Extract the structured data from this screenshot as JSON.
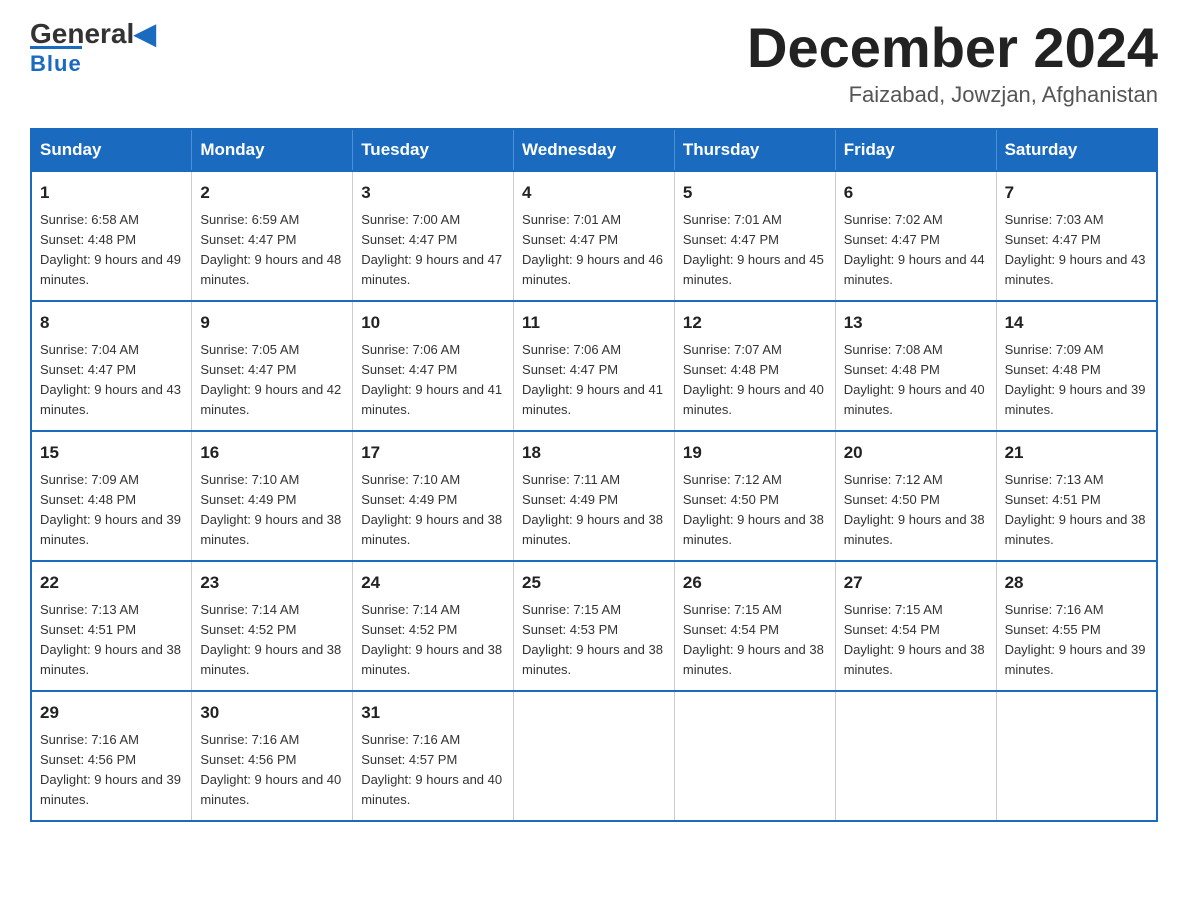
{
  "header": {
    "logo": {
      "general": "General",
      "blue": "Blue",
      "arrow": "▶"
    },
    "title": "December 2024",
    "location": "Faizabad, Jowzjan, Afghanistan"
  },
  "days_of_week": [
    "Sunday",
    "Monday",
    "Tuesday",
    "Wednesday",
    "Thursday",
    "Friday",
    "Saturday"
  ],
  "weeks": [
    [
      {
        "day": "1",
        "sunrise": "Sunrise: 6:58 AM",
        "sunset": "Sunset: 4:48 PM",
        "daylight": "Daylight: 9 hours and 49 minutes."
      },
      {
        "day": "2",
        "sunrise": "Sunrise: 6:59 AM",
        "sunset": "Sunset: 4:47 PM",
        "daylight": "Daylight: 9 hours and 48 minutes."
      },
      {
        "day": "3",
        "sunrise": "Sunrise: 7:00 AM",
        "sunset": "Sunset: 4:47 PM",
        "daylight": "Daylight: 9 hours and 47 minutes."
      },
      {
        "day": "4",
        "sunrise": "Sunrise: 7:01 AM",
        "sunset": "Sunset: 4:47 PM",
        "daylight": "Daylight: 9 hours and 46 minutes."
      },
      {
        "day": "5",
        "sunrise": "Sunrise: 7:01 AM",
        "sunset": "Sunset: 4:47 PM",
        "daylight": "Daylight: 9 hours and 45 minutes."
      },
      {
        "day": "6",
        "sunrise": "Sunrise: 7:02 AM",
        "sunset": "Sunset: 4:47 PM",
        "daylight": "Daylight: 9 hours and 44 minutes."
      },
      {
        "day": "7",
        "sunrise": "Sunrise: 7:03 AM",
        "sunset": "Sunset: 4:47 PM",
        "daylight": "Daylight: 9 hours and 43 minutes."
      }
    ],
    [
      {
        "day": "8",
        "sunrise": "Sunrise: 7:04 AM",
        "sunset": "Sunset: 4:47 PM",
        "daylight": "Daylight: 9 hours and 43 minutes."
      },
      {
        "day": "9",
        "sunrise": "Sunrise: 7:05 AM",
        "sunset": "Sunset: 4:47 PM",
        "daylight": "Daylight: 9 hours and 42 minutes."
      },
      {
        "day": "10",
        "sunrise": "Sunrise: 7:06 AM",
        "sunset": "Sunset: 4:47 PM",
        "daylight": "Daylight: 9 hours and 41 minutes."
      },
      {
        "day": "11",
        "sunrise": "Sunrise: 7:06 AM",
        "sunset": "Sunset: 4:47 PM",
        "daylight": "Daylight: 9 hours and 41 minutes."
      },
      {
        "day": "12",
        "sunrise": "Sunrise: 7:07 AM",
        "sunset": "Sunset: 4:48 PM",
        "daylight": "Daylight: 9 hours and 40 minutes."
      },
      {
        "day": "13",
        "sunrise": "Sunrise: 7:08 AM",
        "sunset": "Sunset: 4:48 PM",
        "daylight": "Daylight: 9 hours and 40 minutes."
      },
      {
        "day": "14",
        "sunrise": "Sunrise: 7:09 AM",
        "sunset": "Sunset: 4:48 PM",
        "daylight": "Daylight: 9 hours and 39 minutes."
      }
    ],
    [
      {
        "day": "15",
        "sunrise": "Sunrise: 7:09 AM",
        "sunset": "Sunset: 4:48 PM",
        "daylight": "Daylight: 9 hours and 39 minutes."
      },
      {
        "day": "16",
        "sunrise": "Sunrise: 7:10 AM",
        "sunset": "Sunset: 4:49 PM",
        "daylight": "Daylight: 9 hours and 38 minutes."
      },
      {
        "day": "17",
        "sunrise": "Sunrise: 7:10 AM",
        "sunset": "Sunset: 4:49 PM",
        "daylight": "Daylight: 9 hours and 38 minutes."
      },
      {
        "day": "18",
        "sunrise": "Sunrise: 7:11 AM",
        "sunset": "Sunset: 4:49 PM",
        "daylight": "Daylight: 9 hours and 38 minutes."
      },
      {
        "day": "19",
        "sunrise": "Sunrise: 7:12 AM",
        "sunset": "Sunset: 4:50 PM",
        "daylight": "Daylight: 9 hours and 38 minutes."
      },
      {
        "day": "20",
        "sunrise": "Sunrise: 7:12 AM",
        "sunset": "Sunset: 4:50 PM",
        "daylight": "Daylight: 9 hours and 38 minutes."
      },
      {
        "day": "21",
        "sunrise": "Sunrise: 7:13 AM",
        "sunset": "Sunset: 4:51 PM",
        "daylight": "Daylight: 9 hours and 38 minutes."
      }
    ],
    [
      {
        "day": "22",
        "sunrise": "Sunrise: 7:13 AM",
        "sunset": "Sunset: 4:51 PM",
        "daylight": "Daylight: 9 hours and 38 minutes."
      },
      {
        "day": "23",
        "sunrise": "Sunrise: 7:14 AM",
        "sunset": "Sunset: 4:52 PM",
        "daylight": "Daylight: 9 hours and 38 minutes."
      },
      {
        "day": "24",
        "sunrise": "Sunrise: 7:14 AM",
        "sunset": "Sunset: 4:52 PM",
        "daylight": "Daylight: 9 hours and 38 minutes."
      },
      {
        "day": "25",
        "sunrise": "Sunrise: 7:15 AM",
        "sunset": "Sunset: 4:53 PM",
        "daylight": "Daylight: 9 hours and 38 minutes."
      },
      {
        "day": "26",
        "sunrise": "Sunrise: 7:15 AM",
        "sunset": "Sunset: 4:54 PM",
        "daylight": "Daylight: 9 hours and 38 minutes."
      },
      {
        "day": "27",
        "sunrise": "Sunrise: 7:15 AM",
        "sunset": "Sunset: 4:54 PM",
        "daylight": "Daylight: 9 hours and 38 minutes."
      },
      {
        "day": "28",
        "sunrise": "Sunrise: 7:16 AM",
        "sunset": "Sunset: 4:55 PM",
        "daylight": "Daylight: 9 hours and 39 minutes."
      }
    ],
    [
      {
        "day": "29",
        "sunrise": "Sunrise: 7:16 AM",
        "sunset": "Sunset: 4:56 PM",
        "daylight": "Daylight: 9 hours and 39 minutes."
      },
      {
        "day": "30",
        "sunrise": "Sunrise: 7:16 AM",
        "sunset": "Sunset: 4:56 PM",
        "daylight": "Daylight: 9 hours and 40 minutes."
      },
      {
        "day": "31",
        "sunrise": "Sunrise: 7:16 AM",
        "sunset": "Sunset: 4:57 PM",
        "daylight": "Daylight: 9 hours and 40 minutes."
      },
      null,
      null,
      null,
      null
    ]
  ]
}
